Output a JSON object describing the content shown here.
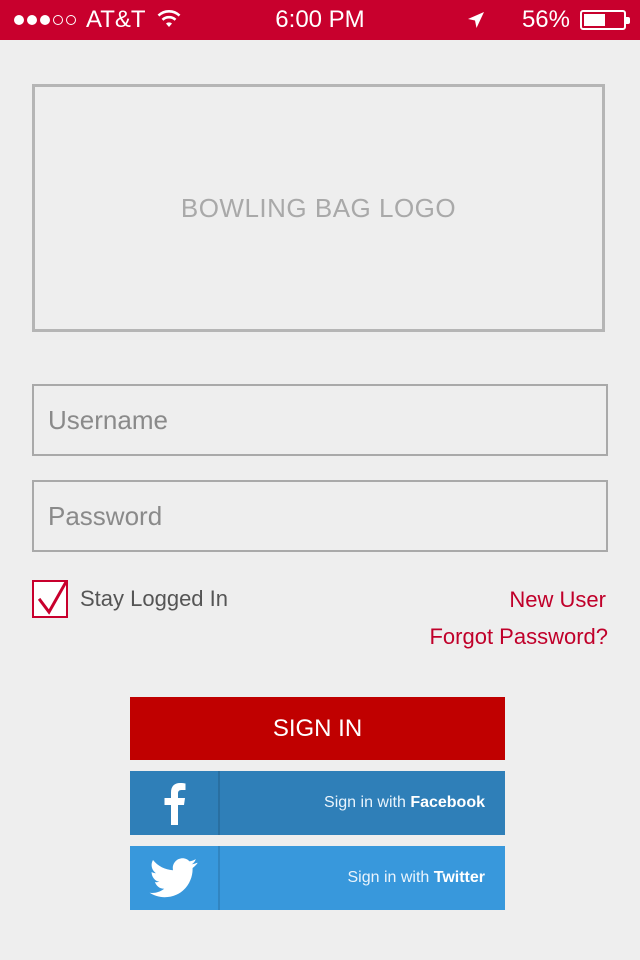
{
  "status_bar": {
    "carrier": "AT&T",
    "signal_filled": 3,
    "signal_total": 5,
    "time": "6:00 PM",
    "battery_percent": "56%",
    "battery_level": 0.56
  },
  "logo": {
    "text": "BOWLING BAG LOGO"
  },
  "form": {
    "username_placeholder": "Username",
    "password_placeholder": "Password",
    "stay_logged_in_label": "Stay Logged In",
    "stay_logged_in_checked": true
  },
  "links": {
    "new_user": "New User",
    "forgot_password": "Forgot Password?"
  },
  "buttons": {
    "sign_in": "SIGN IN",
    "facebook_prefix": "Sign in with ",
    "facebook_brand": "Facebook",
    "twitter_prefix": "Sign in with ",
    "twitter_brand": "Twitter"
  },
  "colors": {
    "accent": "#c8002d",
    "sign_in_button": "#c00000",
    "facebook": "#2f7fb8",
    "twitter": "#3898dc"
  }
}
